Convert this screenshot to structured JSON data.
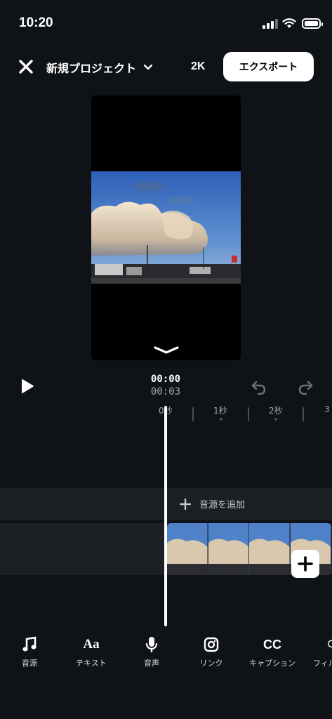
{
  "status_bar": {
    "time": "10:20"
  },
  "header": {
    "project_title": "新規プロジェクト",
    "resolution": "2K",
    "export_label": "エクスポート"
  },
  "playback": {
    "current_time": "00:00",
    "total_time": "00:03"
  },
  "timeline": {
    "ruler_labels": [
      "0秒",
      "1秒",
      "2秒",
      "3"
    ],
    "add_audio_label": "音源を追加"
  },
  "toolbar": {
    "items": [
      {
        "label": "音源",
        "icon": "music-note-icon"
      },
      {
        "label": "テキスト",
        "icon": "text-icon",
        "glyph": "Aa"
      },
      {
        "label": "音声",
        "icon": "microphone-icon"
      },
      {
        "label": "リンク",
        "icon": "instagram-icon"
      },
      {
        "label": "キャプション",
        "icon": "captions-icon",
        "glyph": "CC"
      },
      {
        "label": "フィル",
        "icon": "filter-icon"
      }
    ]
  },
  "colors": {
    "background": "#0f1216",
    "track": "#1c2025",
    "accent": "#ffffff"
  }
}
